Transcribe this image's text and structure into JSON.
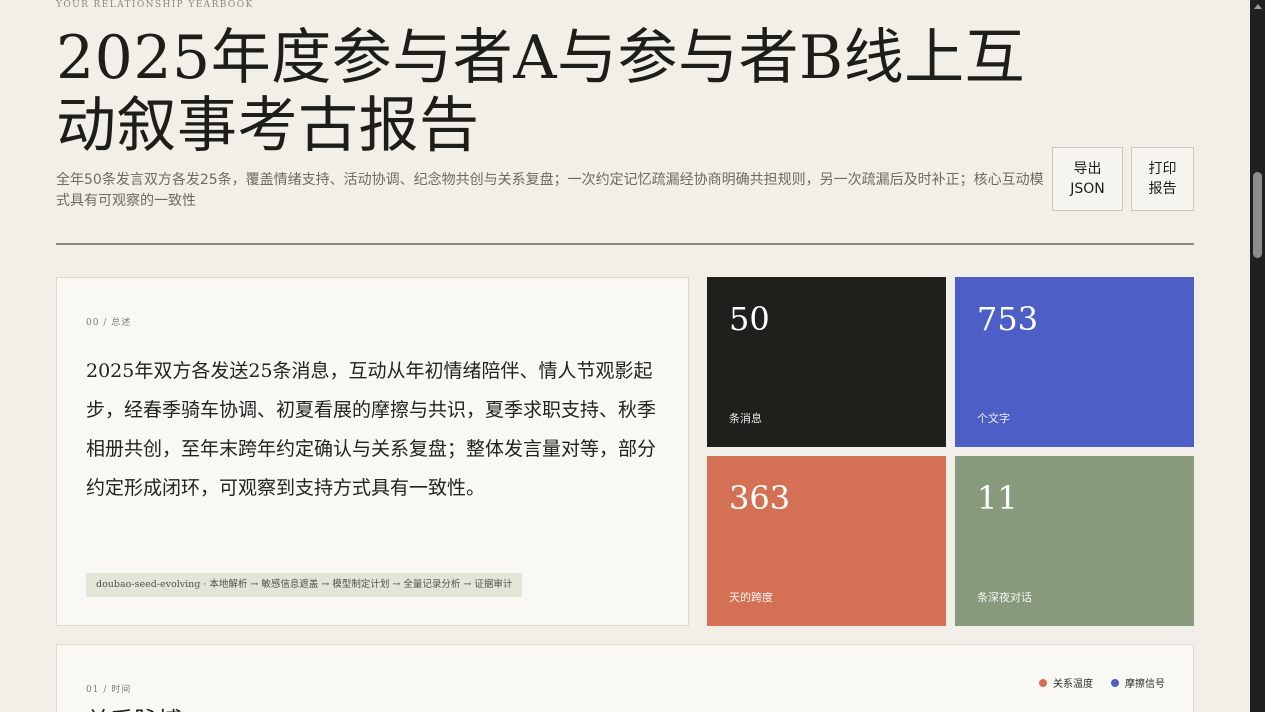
{
  "header": {
    "eyebrow": "YOUR RELATIONSHIP YEARBOOK",
    "title": "2025年度参与者A与参与者B线上互动叙事考古报告",
    "subtitle": "全年50条发言双方各发25条，覆盖情绪支持、活动协调、纪念物共创与关系复盘；一次约定记忆疏漏经协商明确共担规则，另一次疏漏后及时补正；核心互动模式具有可观察的一致性"
  },
  "actions": {
    "export_label": "导出\nJSON",
    "print_label": "打印\n报告"
  },
  "overview": {
    "section_label": "00 / 总述",
    "text": "2025年双方各发送25条消息，互动从年初情绪陪伴、情人节观影起步，经春季骑车协调、初夏看展的摩擦与共识，夏季求职支持、秋季相册共创，至年末跨年约定确认与关系复盘；整体发言量对等，部分约定形成闭环，可观察到支持方式具有一致性。",
    "pipeline": "doubao-seed-evolving · 本地解析 → 敏感信息遮盖 → 模型制定计划 → 全量记录分析 → 证据审计"
  },
  "stats": [
    {
      "value": "50",
      "label": "条消息",
      "color": "#1f1f1b"
    },
    {
      "value": "753",
      "label": "个文字",
      "color": "#4d5fc7"
    },
    {
      "value": "363",
      "label": "天的跨度",
      "color": "#d47154"
    },
    {
      "value": "11",
      "label": "条深夜对话",
      "color": "#889a7c"
    }
  ],
  "timeline": {
    "section_label": "01 / 时间",
    "title": "关系脉搏",
    "legend": [
      {
        "label": "关系温度",
        "color": "#d47154"
      },
      {
        "label": "摩擦信号",
        "color": "#4d5fc7"
      }
    ]
  }
}
